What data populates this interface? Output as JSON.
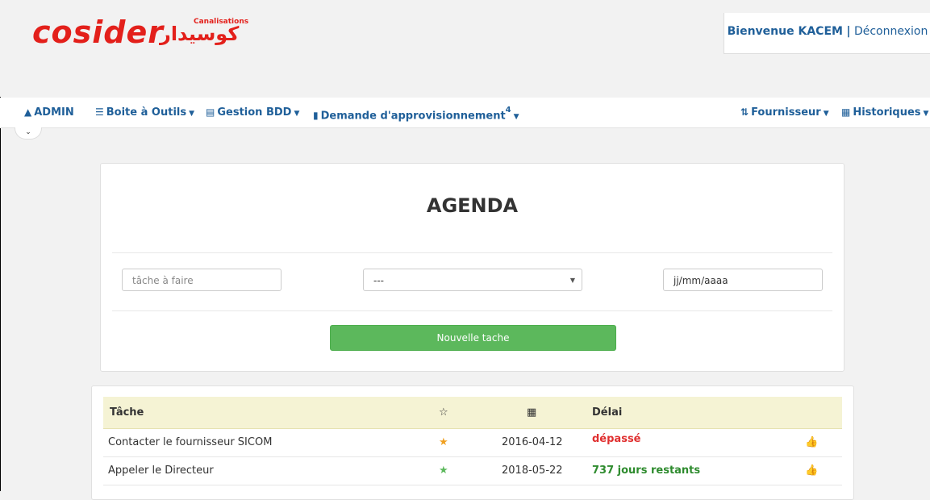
{
  "header": {
    "logo_latin": "cosider",
    "logo_arabic": "كوسيدار",
    "logo_sub": "Canalisations",
    "welcome_prefix": "Bienvenue KACEM",
    "separator": "|",
    "logout": "Déconnexion"
  },
  "nav": {
    "admin": "ADMIN",
    "tools": "Boite à Outils",
    "gestion": "Gestion BDD",
    "demande": "Demande d'approvisionnement",
    "demande_count": "4",
    "fournisseur": "Fournisseur",
    "historiques": "Historiques"
  },
  "agenda": {
    "title": "AGENDA",
    "task_placeholder": "tâche à faire",
    "select_value": "---",
    "date_value": "jj/mm/aaaa",
    "new_button": "Nouvelle tache"
  },
  "table": {
    "headers": {
      "task": "Tâche",
      "star": "☆",
      "calendar": "▦",
      "delai": "Délai"
    },
    "rows": [
      {
        "task": "Contacter le fournisseur SICOM",
        "star_color": "#f0a020",
        "date": "2016-04-12",
        "delai": "dépassé",
        "delai_color": "#e03030"
      },
      {
        "task": "Appeler le Directeur",
        "star_color": "#5cb85c",
        "date": "2018-05-22",
        "delai": "737 jours restants",
        "delai_color": "#2e8b2e"
      }
    ]
  },
  "colors": {
    "brand": "#e3201b",
    "link": "#1f5f99",
    "success": "#5cb85c"
  }
}
